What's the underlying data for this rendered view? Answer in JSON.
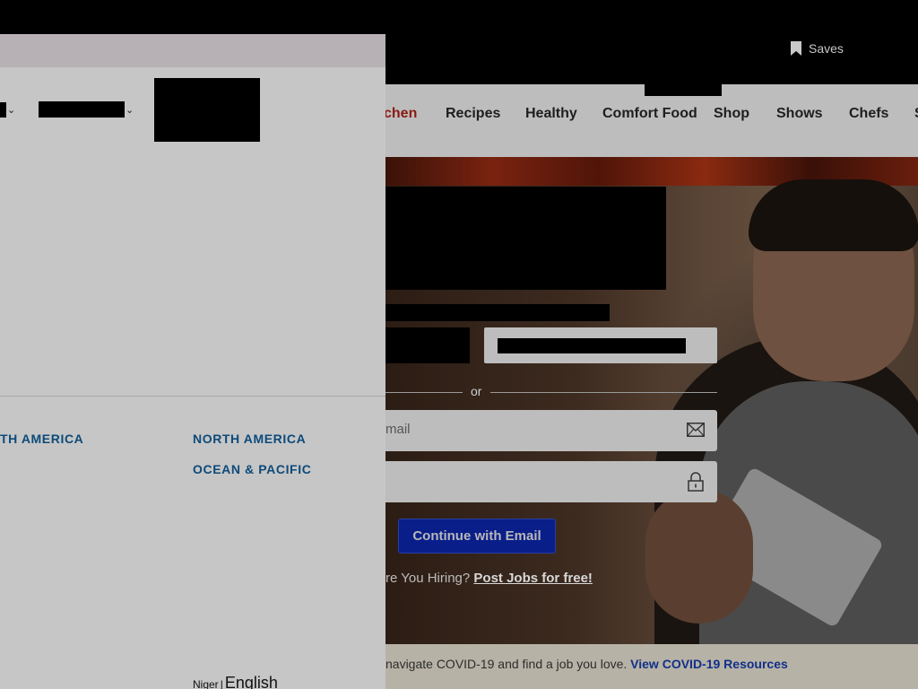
{
  "header": {
    "saves_label": "Saves"
  },
  "nav": {
    "items": [
      {
        "label": "chen",
        "active": true
      },
      {
        "label": "Recipes"
      },
      {
        "label": "Healthy"
      },
      {
        "label": "Comfort Food"
      },
      {
        "label": "Shop"
      },
      {
        "label": "Shows"
      },
      {
        "label": "Chefs"
      },
      {
        "label": "S"
      }
    ]
  },
  "signup": {
    "or_label": "or",
    "email_placeholder": "mail",
    "continue_label": "Continue with Email",
    "hiring_prefix": "re You Hiring?",
    "hiring_link": "Post Jobs for free!"
  },
  "covid": {
    "text": "navigate COVID-19 and find a job you love.",
    "link": "View COVID-19 Resources"
  },
  "panel": {
    "regions": {
      "col1_item1": "TH AMERICA",
      "col2_item1": "NORTH AMERICA",
      "col2_item2": "OCEAN & PACIFIC"
    },
    "language": {
      "country": "Niger",
      "separator": "|",
      "language": "English"
    }
  },
  "icons": {
    "saves": "bookmark-icon",
    "email": "envelope-icon",
    "password": "lock-icon",
    "dropdown": "chevron-down-icon"
  },
  "colors": {
    "cta_blue": "#0a1e8a",
    "region_link": "#0d4a7a",
    "covid_link": "#10308a",
    "nav_active": "#8a1a12"
  }
}
